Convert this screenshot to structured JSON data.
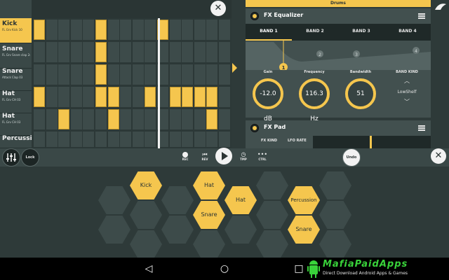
{
  "sequencer": {
    "swing_label": "SWING",
    "tracks": [
      {
        "name": "Kick",
        "sub": "FL Grv Kick 10",
        "selected": true
      },
      {
        "name": "Snare",
        "sub": "FL Grv Snare clap 24",
        "selected": false
      },
      {
        "name": "Snare",
        "sub": "Attack Clap 03",
        "selected": false
      },
      {
        "name": "Hat",
        "sub": "FL Grv CH 03",
        "selected": false
      },
      {
        "name": "Hat",
        "sub": "FL Grv CH 03",
        "selected": false
      },
      {
        "name": "Percussion",
        "sub": "",
        "selected": false
      }
    ],
    "pattern": [
      [
        1,
        0,
        0,
        0,
        0,
        1,
        0,
        0,
        0,
        0,
        1,
        0,
        0,
        0,
        0,
        0
      ],
      [
        0,
        0,
        0,
        0,
        0,
        1,
        0,
        0,
        0,
        0,
        0,
        0,
        0,
        0,
        0,
        0
      ],
      [
        0,
        0,
        0,
        0,
        0,
        1,
        0,
        0,
        0,
        0,
        0,
        0,
        0,
        0,
        0,
        0
      ],
      [
        1,
        0,
        0,
        0,
        0,
        1,
        1,
        0,
        0,
        1,
        0,
        1,
        1,
        1,
        1,
        0
      ],
      [
        0,
        0,
        1,
        0,
        0,
        0,
        1,
        0,
        0,
        0,
        0,
        0,
        0,
        0,
        1,
        0
      ],
      [
        0,
        0,
        0,
        0,
        0,
        0,
        0,
        0,
        0,
        0,
        0,
        0,
        0,
        0,
        0,
        0
      ]
    ]
  },
  "right_panel": {
    "drums_tab": "Drums",
    "fx_eq": {
      "title": "FX Equalizer",
      "bands": [
        "BAND 1",
        "BAND 2",
        "BAND 3",
        "BAND 4"
      ],
      "selected_band": 0,
      "eq_points": [
        "1",
        "2",
        "3",
        "4"
      ],
      "labels": {
        "gain": "Gain",
        "frequency": "Frequency",
        "bandwidth": "Bandwidth",
        "band_kind": "BAND KIND"
      },
      "values": {
        "gain": "-12.0 dB",
        "frequency": "116.3 Hz",
        "bandwidth": "51",
        "band_kind": "LowShelf"
      }
    },
    "fx_pad": {
      "title": "FX Pad",
      "fx_kind_label": "FX KIND",
      "lfo_rate_label": "LFO RATE"
    }
  },
  "transport": {
    "lock_label": "Lock",
    "rec_label": "REC",
    "rev_label": "REV",
    "tmp_label": "TMP",
    "ctrl_label": "CTRL",
    "undo_label": "Undo"
  },
  "pads": [
    {
      "label": "Kick",
      "on": true
    },
    {
      "label": "Hat",
      "on": true
    },
    {
      "label": "Hat",
      "on": true
    },
    {
      "label": "Snare",
      "on": true
    },
    {
      "label": "Snare",
      "on": true
    },
    {
      "label": "Percussion",
      "on": true
    }
  ],
  "watermark": {
    "title": "MafiaPaidApps",
    "sub": "Direct Download Android Apps & Games"
  },
  "colors": {
    "accent": "#f5c64e",
    "background": "#2e3a39",
    "panel": "#42504f",
    "dark": "#1f2928"
  }
}
